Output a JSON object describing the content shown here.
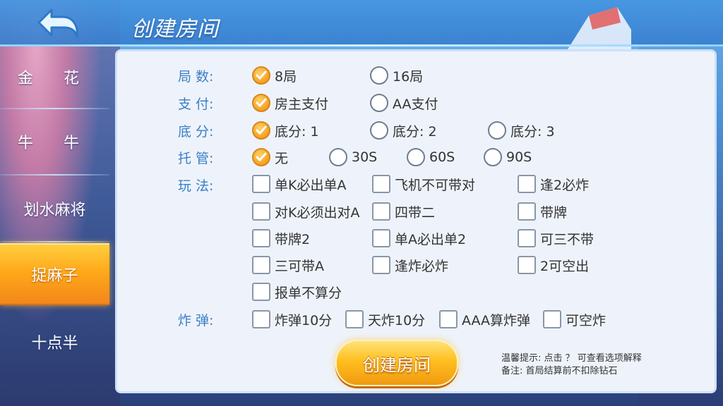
{
  "page_title": "创建房间",
  "sidebar": {
    "items": [
      {
        "label": "金 花",
        "active": false
      },
      {
        "label": "牛 牛",
        "active": false
      },
      {
        "label": "划水麻将",
        "active": false
      },
      {
        "label": "捉麻子",
        "active": true
      },
      {
        "label": "十点半",
        "active": false
      }
    ]
  },
  "rows": {
    "rounds": {
      "label": "局  数:",
      "options": [
        {
          "text": "8局",
          "checked": true
        },
        {
          "text": "16局",
          "checked": false
        }
      ]
    },
    "payment": {
      "label": "支  付:",
      "options": [
        {
          "text": "房主支付",
          "checked": true
        },
        {
          "text": "AA支付",
          "checked": false
        }
      ]
    },
    "base_score": {
      "label": "底  分:",
      "options": [
        {
          "text": "底分: 1",
          "checked": true
        },
        {
          "text": "底分: 2",
          "checked": false
        },
        {
          "text": "底分: 3",
          "checked": false
        }
      ]
    },
    "hosting": {
      "label": "托  管:",
      "options": [
        {
          "text": "无",
          "checked": true
        },
        {
          "text": "30S",
          "checked": false
        },
        {
          "text": "60S",
          "checked": false
        },
        {
          "text": "90S",
          "checked": false
        }
      ]
    },
    "play_rules": {
      "label": "玩  法:",
      "options": [
        {
          "text": "单K必出单A",
          "checked": false
        },
        {
          "text": "飞机不可带对",
          "checked": false
        },
        {
          "text": "逢2必炸",
          "checked": false
        },
        {
          "text": "对K必须出对A",
          "checked": false
        },
        {
          "text": "四带二",
          "checked": false
        },
        {
          "text": "带牌",
          "checked": false
        },
        {
          "text": "带牌2",
          "checked": false
        },
        {
          "text": "单A必出单2",
          "checked": false
        },
        {
          "text": "可三不带",
          "checked": false
        },
        {
          "text": "三可带A",
          "checked": false
        },
        {
          "text": "逢炸必炸",
          "checked": false
        },
        {
          "text": "2可空出",
          "checked": false
        },
        {
          "text": "报单不算分",
          "checked": false
        }
      ]
    },
    "bombs": {
      "label": "炸  弹:",
      "options": [
        {
          "text": "炸弹10分",
          "checked": false
        },
        {
          "text": "天炸10分",
          "checked": false
        },
        {
          "text": "AAA算炸弹",
          "checked": false
        },
        {
          "text": "可空炸",
          "checked": false
        }
      ]
    }
  },
  "create_button": "创建房间",
  "tips": {
    "line1": "温馨提示: 点击 ？ 可查看选项解释",
    "line2": "备注: 首局结算前不扣除钻石"
  },
  "colors": {
    "accent": "#f5a021",
    "label_blue": "#3a7fc6",
    "panel_bg": "#eef3fb"
  },
  "icons": {
    "back": "back-arrow-icon",
    "check": "checkmark-icon"
  }
}
